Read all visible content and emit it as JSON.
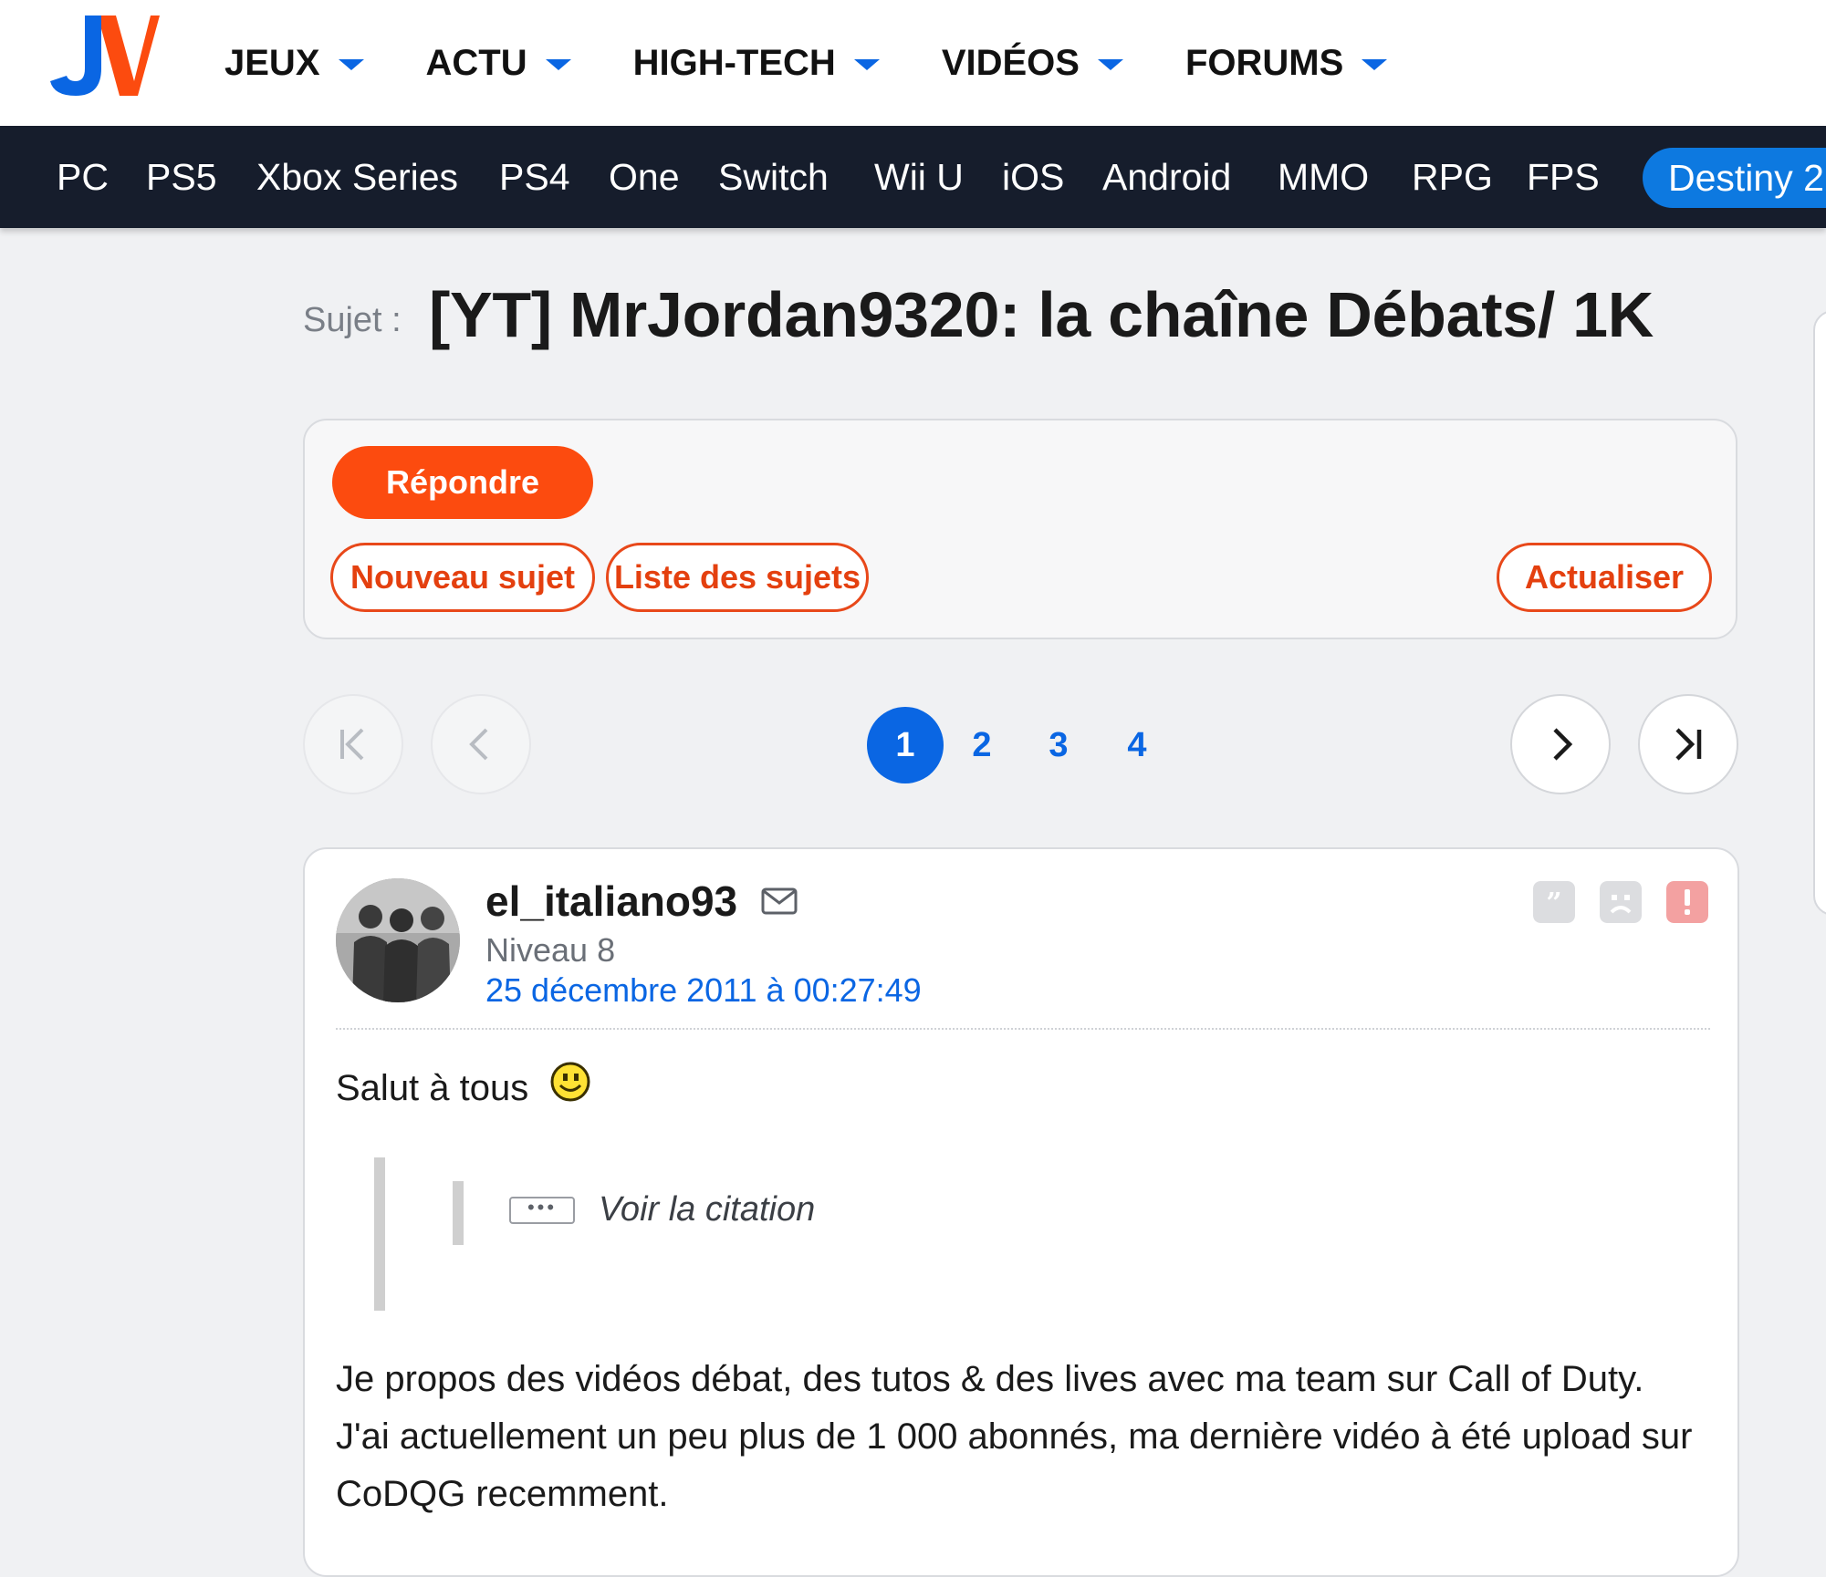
{
  "header": {
    "logo_alt": "JV",
    "main_nav": [
      {
        "label": "JEUX"
      },
      {
        "label": "ACTU"
      },
      {
        "label": "HIGH-TECH"
      },
      {
        "label": "VIDÉOS"
      },
      {
        "label": "FORUMS"
      }
    ],
    "accent_color": "#0a66e3",
    "logo_colors": {
      "j": "#0a66e3",
      "v": "#fc4b0f"
    }
  },
  "platform_bar": {
    "items": [
      "PC",
      "PS5",
      "Xbox Series",
      "PS4",
      "One",
      "Switch",
      "Wii U",
      "iOS",
      "Android",
      "MMO",
      "RPG",
      "FPS"
    ],
    "highlight": "Destiny 2",
    "background": "#161d2c"
  },
  "topic": {
    "prefix": "Sujet :",
    "title": "[YT] MrJordan9320: la chaîne Débats/ 1K"
  },
  "actions": {
    "reply": "Répondre",
    "new_topic": "Nouveau sujet",
    "topic_list": "Liste des sujets",
    "refresh": "Actualiser",
    "button_color": "#fc4b0f"
  },
  "pagination": {
    "pages": [
      "1",
      "2",
      "3",
      "4"
    ],
    "current": "1",
    "first_icon": "first-page-icon",
    "prev_icon": "prev-page-icon",
    "next_icon": "next-page-icon",
    "last_icon": "last-page-icon"
  },
  "post": {
    "author": "el_italiano93",
    "level": "Niveau 8",
    "date": "25 décembre 2011 à 00:27:49",
    "greeting": "Salut à tous",
    "quote_dots": "•••",
    "quote_label": "Voir la citation",
    "body": "Je propos des vidéos débat, des tutos & des lives avec ma team sur Call of Duty. J'ai actuellement un peu plus de 1 000 abonnés, ma dernière vidéo à été upload sur CoDQG recemment.",
    "icons": [
      "mail-icon",
      "quote-icon",
      "sad-face-icon",
      "report-icon",
      "smiley-icon"
    ]
  }
}
